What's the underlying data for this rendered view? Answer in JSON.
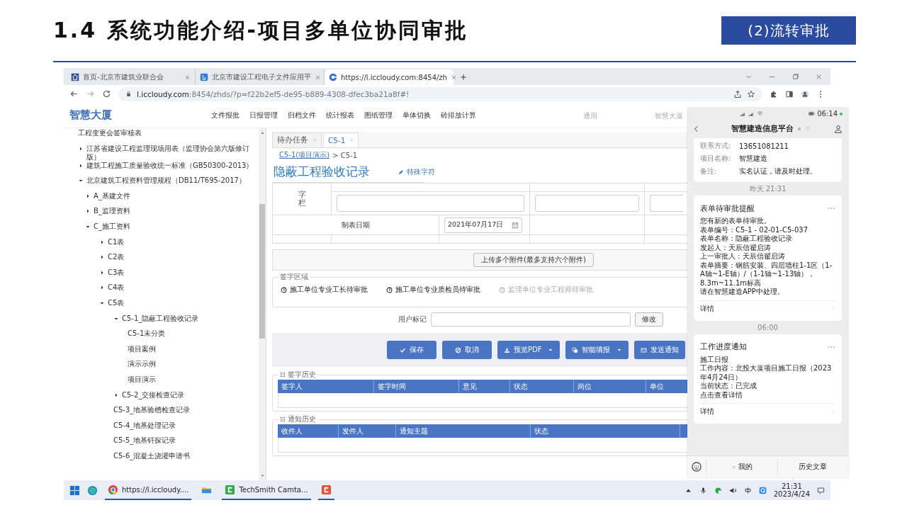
{
  "slide": {
    "title": "1.4 系统功能介绍-项目多单位协同审批",
    "badge": "(2)流转审批"
  },
  "browser": {
    "tabs": [
      {
        "title": "首页-北京市建筑业联合会",
        "selected": false
      },
      {
        "title": "北京市建设工程电子文件应用平",
        "selected": false
      },
      {
        "title": "https://l.iccloudy.com:8454/zh",
        "selected": true
      }
    ],
    "url_host": "l.iccloudy.com",
    "url_path": ":8454/zhds/?p=f22b2ef5-de95-b889-4308-dfec3ba21a8f#!"
  },
  "app": {
    "logo": "智慧大厦",
    "nav": [
      "文件报批",
      "日报管理",
      "归档文件",
      "统计报表",
      "图纸管理",
      "单体切换",
      "砖排放计算"
    ],
    "nav_right": [
      "通用",
      "智慧大厦"
    ]
  },
  "tree": [
    {
      "label": "工程变更会签审核表"
    },
    {
      "label": "江苏省建设工程监理现场用表（监理协会第六版修订版）",
      "expanded": false
    },
    {
      "label": "建筑工程施工质量验收统一标准（GB50300-2013）",
      "expanded": false
    },
    {
      "label": "北京建筑工程资料管理规程（DB11/T695-2017）",
      "expanded": true,
      "children": [
        {
          "label": "A_基建文件",
          "expanded": false
        },
        {
          "label": "B_监理资料",
          "expanded": false
        },
        {
          "label": "C_施工资料",
          "expanded": true,
          "children": [
            {
              "label": "C1表",
              "expanded": false
            },
            {
              "label": "C2表",
              "expanded": false
            },
            {
              "label": "C3表",
              "expanded": false
            },
            {
              "label": "C4表",
              "expanded": false
            },
            {
              "label": "C5表",
              "expanded": true,
              "children": [
                {
                  "label": "C5-1_隐蔽工程验收记录",
                  "expanded": true,
                  "children": [
                    {
                      "label": "C5-1未分类"
                    },
                    {
                      "label": "项目案例"
                    },
                    {
                      "label": "演示示例"
                    },
                    {
                      "label": "项目演示"
                    }
                  ]
                },
                {
                  "label": "C5-2_交接检查记录",
                  "expanded": false
                },
                {
                  "label": "C5-3_地基验槽检查记录"
                },
                {
                  "label": "C5-4_地基处理记录"
                },
                {
                  "label": "C5-5_地基钎探记录"
                },
                {
                  "label": "C5-6_混凝土浇灌申请书"
                }
              ]
            }
          ]
        }
      ]
    }
  ],
  "content_tabs": [
    {
      "label": "待办任务",
      "selected": false
    },
    {
      "label": "C5-1",
      "selected": true
    }
  ],
  "breadcrumb": {
    "link": "C5-1(项目演示)",
    "current": "> C5-1"
  },
  "page_title": "隐蔽工程验收记录",
  "special_chars": "特殊字符",
  "form": {
    "sign_label": "字栏",
    "date_label": "制表日期",
    "date_value": "2021年07月17日"
  },
  "upload_button": "上传多个附件(最多支持六个附件)",
  "sign_area": {
    "legend": "签字区域",
    "steps": [
      {
        "label": "施工单位专业工长待审批",
        "active": true
      },
      {
        "label": "施工单位专业质检员待审批",
        "active": true
      },
      {
        "label": "监理单位专业工程师待审批",
        "active": false
      }
    ]
  },
  "user_mark": {
    "label": "用户标记",
    "button": "修改"
  },
  "actions": [
    {
      "label": "保存",
      "dropdown": false
    },
    {
      "label": "取消",
      "dropdown": false
    },
    {
      "label": "预览PDF",
      "dropdown": true
    },
    {
      "label": "智能填报",
      "dropdown": true
    },
    {
      "label": "发送通知",
      "dropdown": false
    }
  ],
  "sign_history": {
    "legend": "签字历史",
    "columns": [
      "签字人",
      "签字时间",
      "意见",
      "状态",
      "岗位",
      "单位"
    ]
  },
  "notify_history": {
    "legend": "通知历史",
    "columns": [
      "收件人",
      "发件人",
      "通知主题",
      "状态"
    ]
  },
  "phone": {
    "clock": "06:14",
    "title": "智慧建造信息平台",
    "info": [
      {
        "label": "联系方式:",
        "value": "13651081211"
      },
      {
        "label": "项目名称:",
        "value": "智慧建造"
      },
      {
        "label": "备注:",
        "value": "实名认证，请及时处理。"
      }
    ],
    "messages": [
      {
        "time": "昨天 21:31",
        "title": "表单待审批提醒",
        "lines": [
          "您有新的表单待审批。",
          "表单编号：C5-1 - 02-01-C5-037",
          "表单名称：隐蔽工程验收记录",
          "发起人：天辰信翟启涛",
          "上一审批人：天辰信翟启涛",
          "表单摘要：钢筋安装、四层墙柱1-1区（1-A轴~1-E轴）/（1-1轴~1-13轴），8.3m~11.1m标高",
          "请在智慧建造APP中处理。"
        ],
        "footer": "详情"
      },
      {
        "time": "06:00",
        "title": "工作进度通知",
        "lines": [
          "施工日报",
          "工作内容：北投大厦项目施工日报（2023年4月24日）",
          "当前状态：已完成",
          "点击查看详情"
        ],
        "footer": "详情"
      }
    ],
    "bottom_menu": [
      "我的",
      "历史文章"
    ]
  },
  "taskbar": {
    "apps": [
      {
        "label": "https://l.iccloudy....",
        "open": true
      },
      {
        "open": false
      },
      {
        "label": "TechSmith Camta...",
        "open": true
      },
      {
        "open": true
      }
    ],
    "time": "21:31",
    "date": "2023/4/24"
  }
}
